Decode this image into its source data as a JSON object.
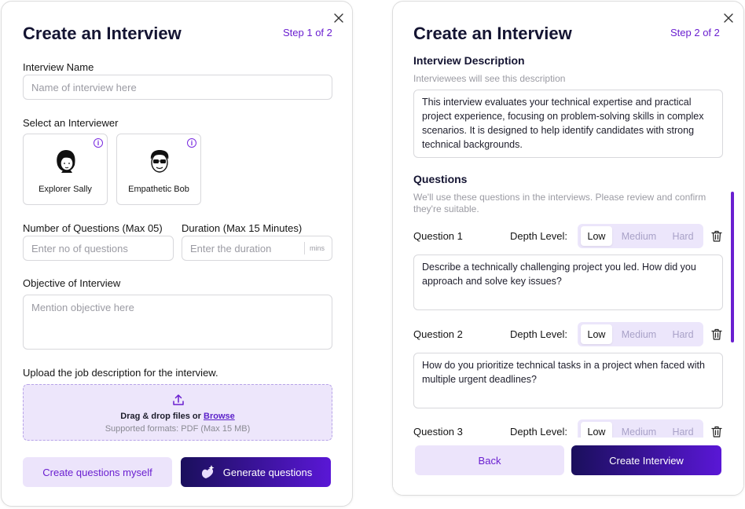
{
  "step1": {
    "title": "Create an Interview",
    "step": "Step 1 of 2",
    "interview_name": {
      "label": "Interview Name",
      "placeholder": "Name of interview here"
    },
    "interviewer_label": "Select an Interviewer",
    "interviewers": [
      {
        "name": "Explorer Sally",
        "icon": "avatar-sally-icon"
      },
      {
        "name": "Empathetic Bob",
        "icon": "avatar-bob-icon"
      }
    ],
    "num_questions": {
      "label": "Number of Questions (Max 05)",
      "placeholder": "Enter no of questions"
    },
    "duration": {
      "label": "Duration (Max 15 Minutes)",
      "placeholder": "Enter the duration",
      "unit": "mins"
    },
    "objective": {
      "label": "Objective of Interview",
      "placeholder": "Mention objective here"
    },
    "upload": {
      "label": "Upload the job description for the interview.",
      "drag_text": "Drag & drop files or ",
      "browse": "Browse",
      "formats": "Supported formats: PDF (Max 15 MB)"
    },
    "btn_myself": "Create questions myself",
    "btn_generate": "Generate questions"
  },
  "step2": {
    "title": "Create an Interview",
    "step": "Step 2 of 2",
    "description_label": "Interview Description",
    "description_hint": "Interviewees will see this description",
    "description": "This interview evaluates your technical expertise and practical project experience, focusing on problem-solving skills in complex scenarios. It is designed to help identify candidates with strong technical backgrounds.",
    "questions_label": "Questions",
    "questions_hint": "We'll use these questions in the interviews. Please review and confirm they're suitable.",
    "depth_label": "Depth Level:",
    "depth_options": [
      "Low",
      "Medium",
      "Hard"
    ],
    "questions": [
      {
        "label": "Question 1",
        "depth": "Low",
        "text": "Describe a technically challenging project you led. How did you approach and solve key issues?"
      },
      {
        "label": "Question 2",
        "depth": "Low",
        "text": "How do you prioritize technical tasks in a project when faced with multiple urgent deadlines?"
      },
      {
        "label": "Question 3",
        "depth": "Low",
        "text": ""
      }
    ],
    "btn_back": "Back",
    "btn_create": "Create Interview"
  },
  "colors": {
    "accent": "#6a1fd0",
    "accent_light": "#ece4fb",
    "dark": "#1a0f5c"
  }
}
